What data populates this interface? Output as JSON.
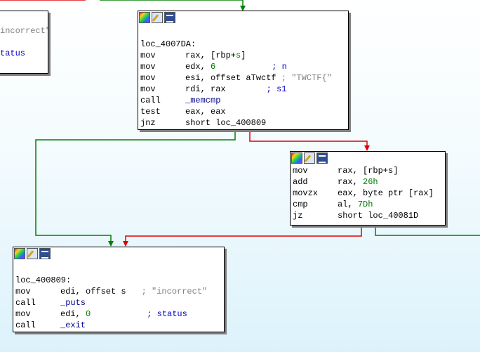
{
  "colors": {
    "edge_true": "#008000",
    "edge_false": "#e00000",
    "edge_uncond": "#008000"
  },
  "node_left": {
    "lines": [
      "incorrect\"",
      "tatus"
    ]
  },
  "node_top": {
    "label": "loc_4007DA:",
    "rows": [
      {
        "m": "mov",
        "a": "rax, [rbp+",
        "a2": "s",
        "a3": "]",
        "c": ""
      },
      {
        "m": "mov",
        "a": "edx, ",
        "num": "6",
        "c": "; n"
      },
      {
        "m": "mov",
        "a": "esi, offset aTwctf",
        "c": "; \"TWCTF{\""
      },
      {
        "m": "mov",
        "a": "rdi, rax",
        "c": "; s1"
      },
      {
        "m": "call",
        "a": "_memcmp",
        "c": ""
      },
      {
        "m": "test",
        "a": "eax, eax",
        "c": ""
      },
      {
        "m": "jnz",
        "a": "short loc_400809",
        "c": ""
      }
    ]
  },
  "node_mid": {
    "rows": [
      {
        "m": "mov",
        "a": "rax, [rbp+s]"
      },
      {
        "m": "add",
        "a": "rax, ",
        "num": "26h"
      },
      {
        "m": "movzx",
        "a": "eax, byte ptr [rax]"
      },
      {
        "m": "cmp",
        "a": "al, ",
        "num": "7Dh"
      },
      {
        "m": "jz",
        "a": "short loc_40081D"
      }
    ]
  },
  "node_bottom": {
    "label": "loc_400809:",
    "rows": [
      {
        "m": "mov",
        "a": "edi, offset s",
        "c": "; \"incorrect\""
      },
      {
        "m": "call",
        "a": "_puts",
        "c": ""
      },
      {
        "m": "mov",
        "a": "edi, ",
        "num": "0",
        "c": "; status"
      },
      {
        "m": "call",
        "a": "_exit",
        "c": ""
      }
    ]
  }
}
